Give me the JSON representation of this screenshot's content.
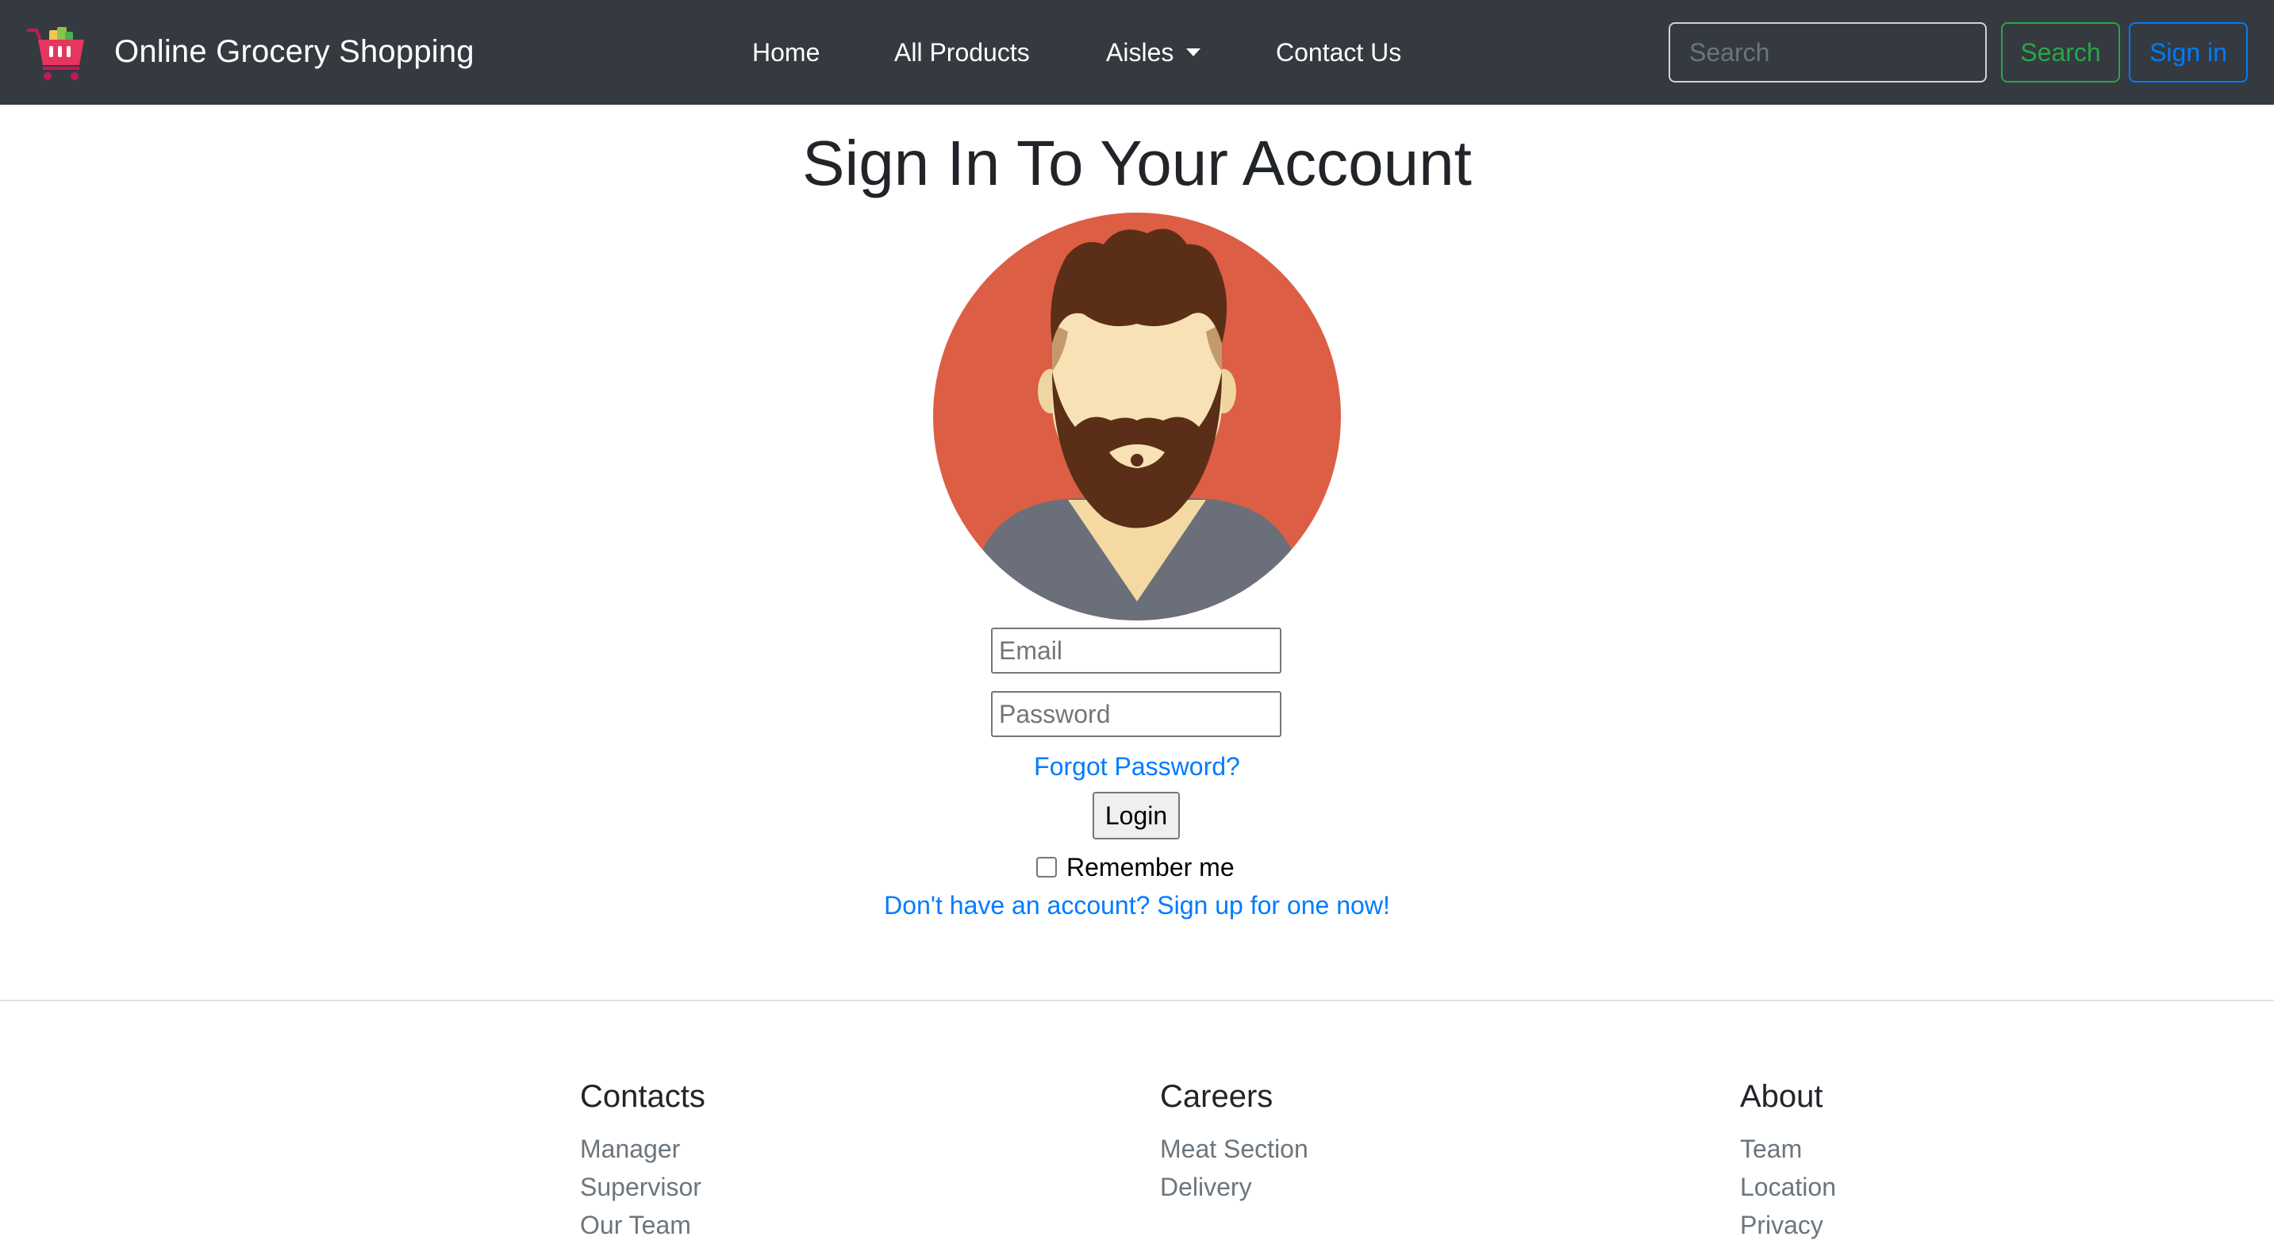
{
  "colors": {
    "navbar_bg": "#343a40",
    "link": "#007bff",
    "search_button": "#28a745",
    "signin_button": "#007bff",
    "avatar_bg": "#dc5e45"
  },
  "navbar": {
    "brand_icon": "shopping-cart-icon",
    "brand_text": "Online Grocery Shopping",
    "links": {
      "home": "Home",
      "all_products": "All Products",
      "aisles": "Aisles",
      "contact_us": "Contact Us"
    },
    "search": {
      "placeholder": "Search",
      "value": "",
      "button_label": "Search"
    },
    "signin_label": "Sign in"
  },
  "main": {
    "title": "Sign In To Your Account",
    "avatar_icon": "bearded-man-avatar-icon",
    "email_placeholder": "Email",
    "password_placeholder": "Password",
    "forgot_password": "Forgot Password?",
    "login_label": "Login",
    "remember_me": "Remember me",
    "remember_checked": false,
    "signup_link": "Don't have an account? Sign up for one now!"
  },
  "footer": {
    "columns": [
      {
        "heading": "Contacts",
        "items": [
          "Manager",
          "Supervisor",
          "Our Team"
        ]
      },
      {
        "heading": "Careers",
        "items": [
          "Meat Section",
          "Delivery"
        ]
      },
      {
        "heading": "About",
        "items": [
          "Team",
          "Location",
          "Privacy"
        ]
      }
    ]
  }
}
